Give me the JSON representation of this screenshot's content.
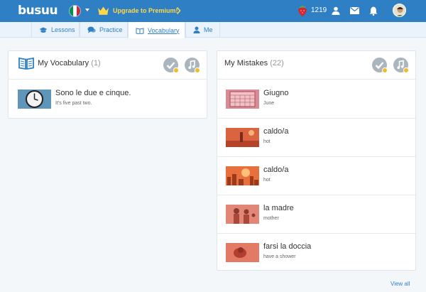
{
  "header": {
    "logo": "busuu",
    "premium_label": "Upgrade to Premium!",
    "points": "1219",
    "flag_colors": [
      "#009246",
      "#ffffff",
      "#ce2b37"
    ]
  },
  "tabs": [
    {
      "label": "Lessons",
      "icon": "graduation-cap-icon"
    },
    {
      "label": "Practice",
      "icon": "speech-bubbles-icon"
    },
    {
      "label": "Vocabulary",
      "icon": "book-icon",
      "active": true
    },
    {
      "label": "Me",
      "icon": "user-icon"
    }
  ],
  "vocabulary": {
    "title": "My Vocabulary",
    "count": "(1)",
    "items": [
      {
        "word": "Sono le due e cinque.",
        "translation": "It's five past two.",
        "image": "clock"
      }
    ]
  },
  "mistakes": {
    "title": "My Mistakes",
    "count": "(22)",
    "items": [
      {
        "word": "Giugno",
        "translation": "June",
        "image": "calendar"
      },
      {
        "word": "caldo/a",
        "translation": "hot",
        "image": "desert-figure"
      },
      {
        "word": "caldo/a",
        "translation": "hot",
        "image": "hot-city"
      },
      {
        "word": "la madre",
        "translation": "mother",
        "image": "mother-family"
      },
      {
        "word": "farsi la doccia",
        "translation": "have a shower",
        "image": "shower"
      }
    ]
  },
  "footer": {
    "view_all": "View all"
  },
  "colors": {
    "brand_blue": "#2f7fc4",
    "premium_yellow": "#ffd84a",
    "mistake_tint": "#e7674e"
  }
}
